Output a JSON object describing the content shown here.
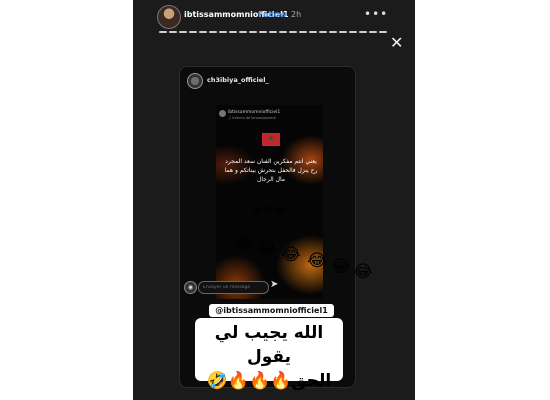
{
  "story": {
    "username": "ibtissammomniofficiel1",
    "follow_label": "Follow",
    "time": "2h",
    "more_icon": "more-icon",
    "close_icon": "close-icon"
  },
  "repost": {
    "username": "ch3ibiya_officiel_",
    "inner": {
      "username": "ibtissammomniofficiel1",
      "subtitle": "♫ Inferno de lanosoljamedi",
      "flag_icon": "morocco-flag-icon",
      "message": "يعني انتم مفكرين الفنان سعد المجرد رح ينزل فالحفل بتحرش بيناتكم و هما مال الرجال",
      "emoji": "😂😂😂",
      "send_placeholder": "Envoyer un message"
    },
    "emoji_chain": "😂😂😂😂😂😂"
  },
  "stickers": {
    "mention": "@ibtissammomniofficiel1",
    "line1": "الله يجيب لي يقول",
    "line2": "الحق🔥🔥🔥🤣"
  }
}
